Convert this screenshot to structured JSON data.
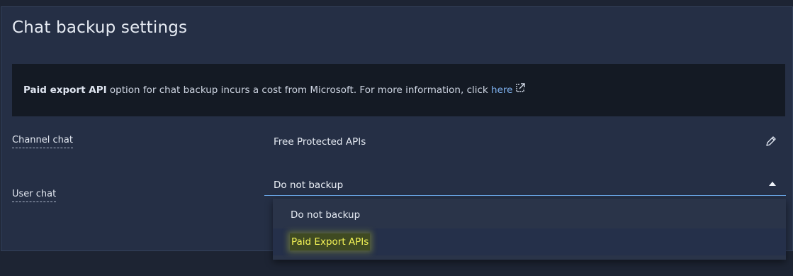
{
  "panel": {
    "title": "Chat backup settings"
  },
  "info": {
    "bold_text": "Paid export API",
    "text": " option for chat backup incurs a cost from Microsoft. For more information, click ",
    "link_text": "here",
    "link_icon": "external-link-icon"
  },
  "rows": {
    "channel_chat": {
      "label": "Channel chat",
      "value": "Free Protected APIs",
      "edit_icon": "pencil-icon"
    },
    "user_chat": {
      "label": "User chat",
      "selected": "Do not backup",
      "caret_icon": "caret-up-icon"
    }
  },
  "dropdown": {
    "options": [
      "Do not backup",
      "Paid Export APIs"
    ],
    "highlighted_index": 1
  },
  "colors": {
    "link": "#7fb2f0",
    "focus_underline": "#6aa6e6",
    "highlight_text": "#f3f356"
  }
}
